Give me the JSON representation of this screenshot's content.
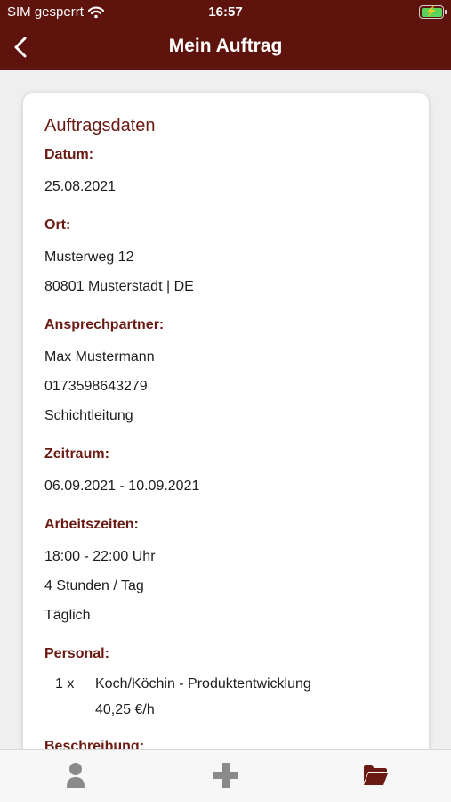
{
  "status": {
    "carrier": "SIM gesperrt",
    "time": "16:57",
    "battery_icon": "battery-charging-icon",
    "wifi_icon": "wifi-icon"
  },
  "nav": {
    "title": "Mein Auftrag",
    "back_icon": "chevron-left-icon"
  },
  "card": {
    "title": "Auftragsdaten",
    "sections": {
      "datum": {
        "label": "Datum:",
        "lines": [
          "25.08.2021"
        ]
      },
      "ort": {
        "label": "Ort:",
        "lines": [
          "Musterweg 12",
          "80801 Musterstadt | DE"
        ]
      },
      "ansprechpartner": {
        "label": "Ansprechpartner:",
        "lines": [
          "Max Mustermann",
          "0173598643279",
          "Schichtleitung"
        ]
      },
      "zeitraum": {
        "label": "Zeitraum:",
        "lines": [
          "06.09.2021 - 10.09.2021"
        ]
      },
      "arbeitszeiten": {
        "label": "Arbeitszeiten:",
        "lines": [
          "18:00 - 22:00 Uhr",
          "4 Stunden / Tag",
          "Täglich"
        ]
      },
      "personal": {
        "label": "Personal:",
        "quantity": "1 x",
        "role": "Koch/Köchin - Produktentwicklung",
        "rate": "40,25 €/h"
      },
      "beschreibung": {
        "label": "Beschreibung:"
      }
    }
  },
  "tabbar": {
    "items": [
      {
        "icon": "person-icon",
        "color": "#8a8a8a"
      },
      {
        "icon": "plus-icon",
        "color": "#8a8a8a"
      },
      {
        "icon": "folder-icon",
        "color": "#6a1a13"
      }
    ]
  },
  "colors": {
    "brand": "#5e130c",
    "accent_text": "#6a1a13",
    "background": "#efefef"
  }
}
